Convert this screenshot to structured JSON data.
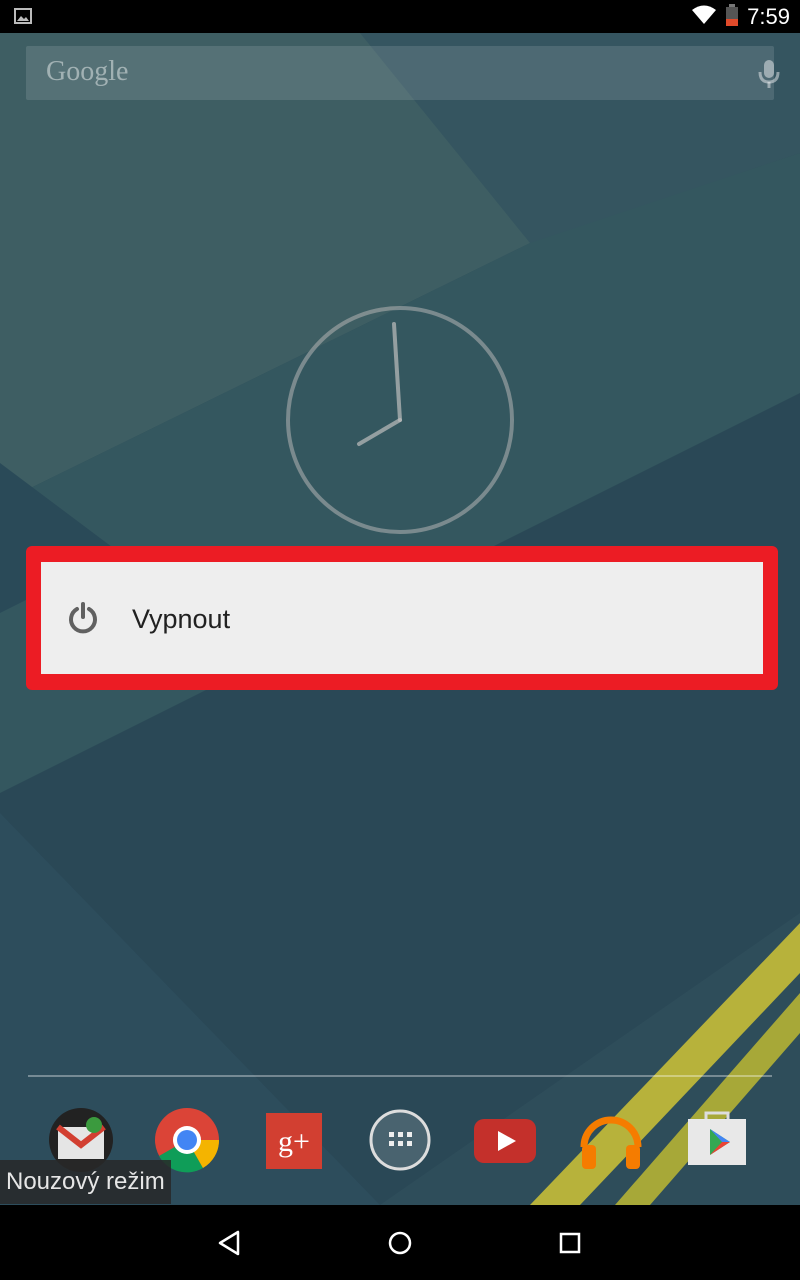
{
  "status_bar": {
    "time": "7:59"
  },
  "search": {
    "logo_text": "Google"
  },
  "dialog": {
    "item_label": "Vypnout"
  },
  "safe_mode_label": "Nouzový režim",
  "dock": {
    "apps": [
      "Gmail",
      "Chrome",
      "Google+",
      "Apps",
      "YouTube",
      "Play Music",
      "Play Store"
    ]
  },
  "colors": {
    "highlight": "#ec1c24",
    "dialog_bg": "#eeeeee",
    "wallpaper": "#2c4a57"
  }
}
